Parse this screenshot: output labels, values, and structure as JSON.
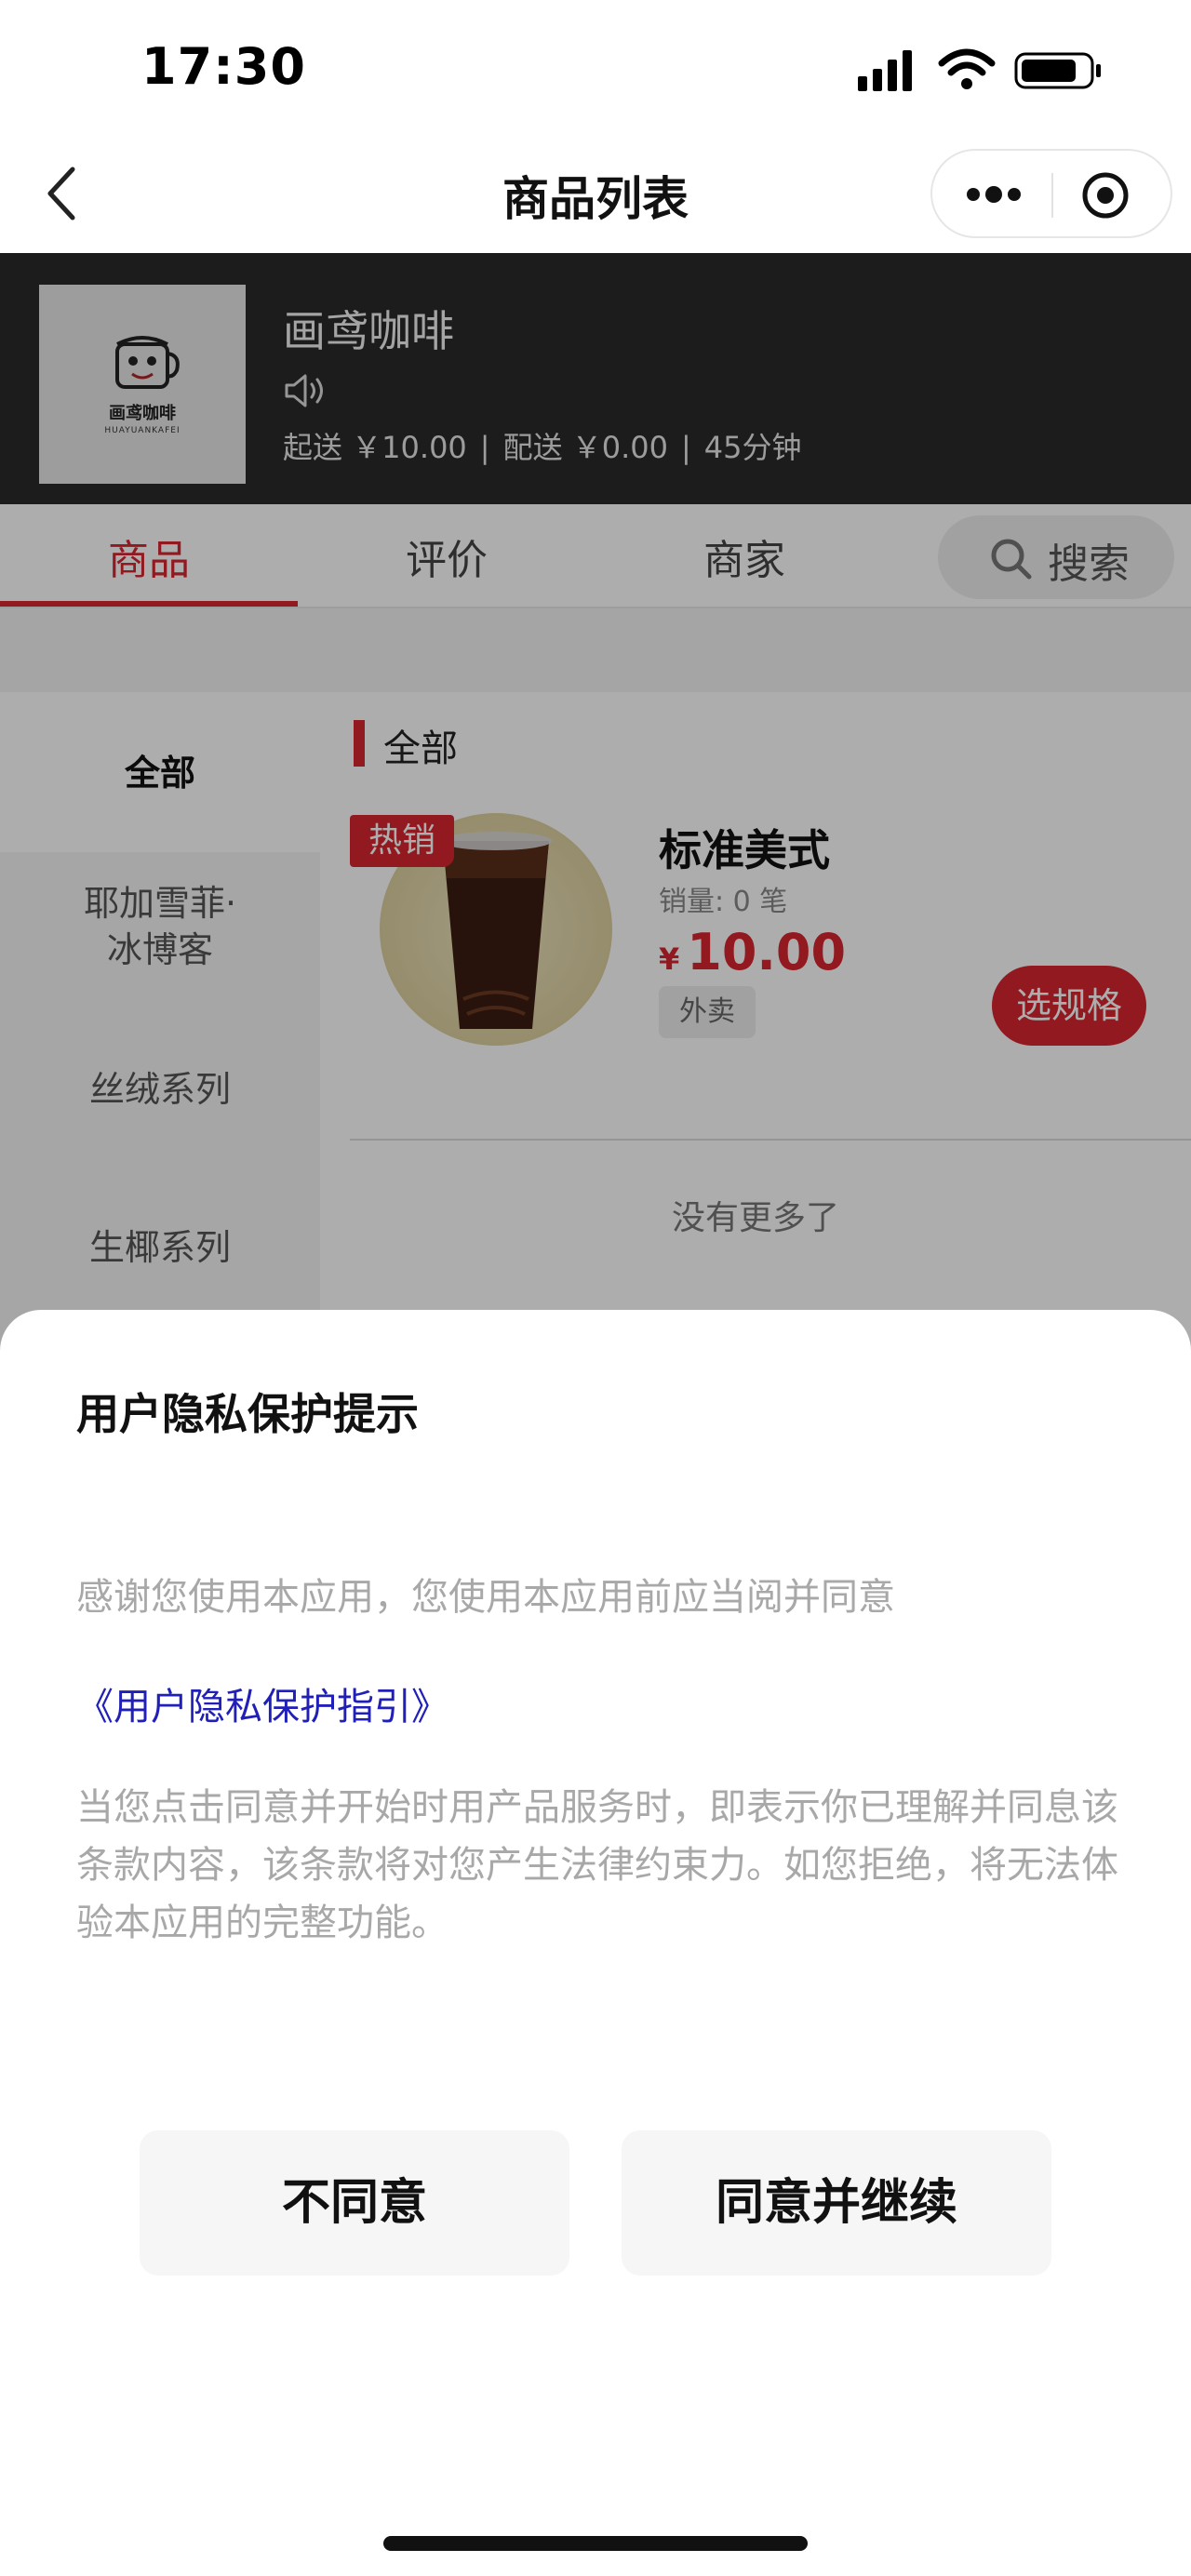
{
  "status_bar": {
    "time": "17:30"
  },
  "nav": {
    "title": "商品列表"
  },
  "store": {
    "name": "画鸢咖啡",
    "logo_text": "画鸢咖啡",
    "logo_subtext": "HUAYUANKAFEI",
    "min_order": "起送 ￥10.00",
    "delivery_fee": "配送 ￥0.00",
    "delivery_time": "45分钟"
  },
  "tabs": [
    "商品",
    "评价",
    "商家"
  ],
  "search": {
    "label": "搜索"
  },
  "categories": [
    "全部",
    "耶加雪菲·\n冰博客",
    "丝绒系列",
    "生椰系列"
  ],
  "section_title": "全部",
  "product": {
    "badge": "热销",
    "name": "标准美式",
    "sales": "销量: 0 笔",
    "currency": "¥",
    "price": "10.00",
    "tag": "外卖",
    "button": "选规格"
  },
  "list_end": "没有更多了",
  "privacy_sheet": {
    "title": "用户隐私保护提示",
    "intro": "感谢您使用本应用，您使用本应用前应当阅并同意",
    "link": "《用户隐私保护指引》",
    "body": "当您点击同意并开始时用产品服务时，即表示你已理解并同息该条款内容，该条款将对您产生法律约束力。如您拒绝，将无法体验本应用的完整功能。",
    "disagree_label": "不同意",
    "agree_label": "同意并继续"
  },
  "colors": {
    "accent": "#d6262f",
    "link": "#2020b8",
    "header_bg": "#2a2a2a"
  },
  "icons": [
    "back-icon",
    "more-icon",
    "target-icon",
    "speaker-icon",
    "search-icon",
    "signal-icon",
    "wifi-icon",
    "battery-icon"
  ]
}
